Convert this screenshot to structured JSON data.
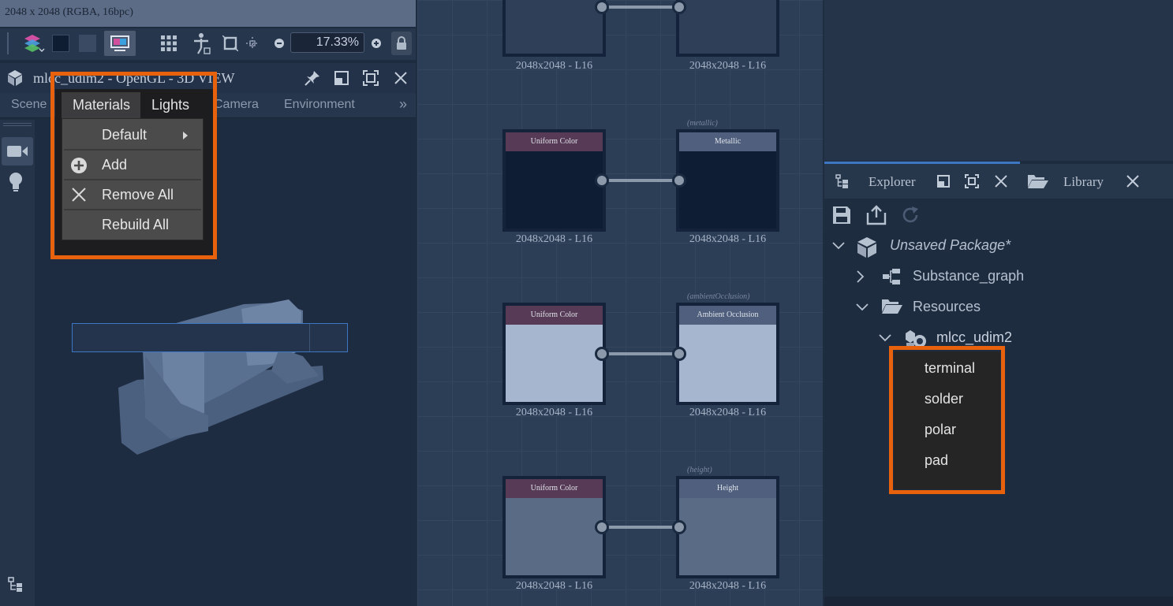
{
  "image_info": "2048 x 2048 (RGBA, 16bpc)",
  "toolbar": {
    "zoom": "17.33%"
  },
  "viewport": {
    "title": "mlcc_udim2 - OpenGL - 3D VIEW",
    "tabs": [
      "Scene",
      "Materials",
      "Lights",
      "Camera",
      "Environment"
    ],
    "more": "»"
  },
  "materials_menu": {
    "tabs": [
      "Materials",
      "Lights"
    ],
    "items": [
      {
        "label": "Default"
      },
      {
        "label": "Add"
      },
      {
        "label": "Remove All"
      },
      {
        "label": "Rebuild All"
      }
    ]
  },
  "graph": {
    "nodes": [
      {
        "header": "",
        "label": "2048x2048 - L16"
      },
      {
        "header": "",
        "label": "2048x2048 - L16"
      },
      {
        "header": "Uniform Color",
        "label": "2048x2048 - L16"
      },
      {
        "header": "Metallic",
        "tag": "(metallic)",
        "label": "2048x2048 - L16"
      },
      {
        "header": "Uniform Color",
        "label": "2048x2048 - L16"
      },
      {
        "header": "Ambient Occlusion",
        "tag": "(ambientOcclusion)",
        "label": "2048x2048 - L16"
      },
      {
        "header": "Uniform Color",
        "label": "2048x2048 - L16"
      },
      {
        "header": "Height",
        "tag": "(height)",
        "label": "2048x2048 - L16"
      }
    ]
  },
  "explorer": {
    "tab_explorer": "Explorer",
    "tab_library": "Library",
    "tree": {
      "package": "Unsaved Package*",
      "graph": "Substance_graph",
      "resources": "Resources",
      "mesh": "mlcc_udim2",
      "materials": [
        "terminal",
        "solder",
        "polar",
        "pad"
      ]
    }
  },
  "colors": {
    "highlight": "#e8610c",
    "selection": "#3d76c2"
  }
}
